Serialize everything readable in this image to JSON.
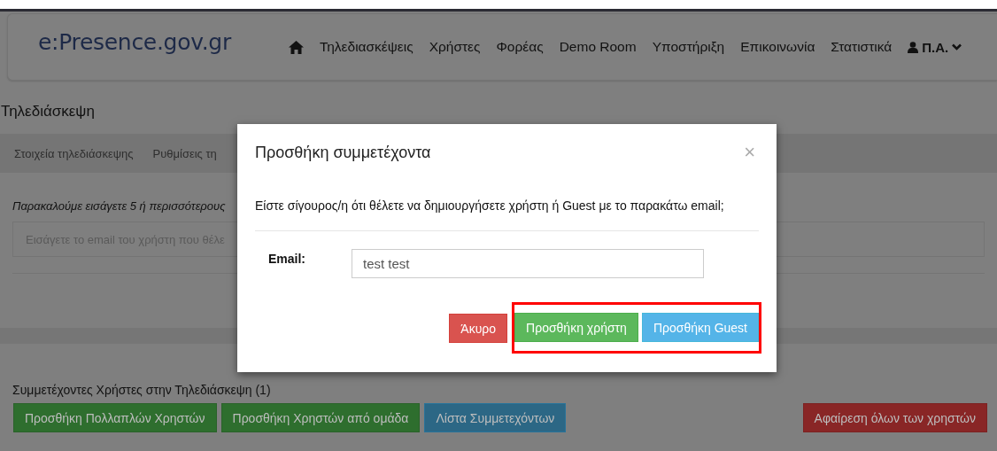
{
  "navbar": {
    "logo": "e:Presence.gov.gr",
    "items": [
      {
        "kind": "home"
      },
      {
        "kind": "link",
        "label": "Τηλεδιασκέψεις"
      },
      {
        "kind": "link",
        "label": "Χρήστες"
      },
      {
        "kind": "link",
        "label": "Φορέας"
      },
      {
        "kind": "link",
        "label": "Demo Room"
      },
      {
        "kind": "link",
        "label": "Υποστήριξη"
      },
      {
        "kind": "link",
        "label": "Επικοινωνία"
      },
      {
        "kind": "link",
        "label": "Στατιστικά"
      },
      {
        "kind": "user",
        "label": "Π.Α."
      }
    ]
  },
  "page": {
    "title": "Τηλεδιάσκεψη",
    "tabs": [
      {
        "label": "Στοιχεία τηλεδιάσκεψης",
        "selected": false
      },
      {
        "label": "Ρυθμίσεις τη",
        "selected": false
      }
    ],
    "instruction": "Παρακαλούμε εισάγετε 5 ή περισσότερους",
    "search": {
      "placeholder": "Εισάγετε το email του χρήστη που θέλε"
    },
    "participants_heading": "Συμμετέχοντες Χρήστες στην Τηλεδιάσκεψη (1)",
    "buttons": [
      {
        "label": "Προσθήκη Πολλαπλών Χρηστών",
        "kind": "success"
      },
      {
        "label": "Προσθήκη Χρηστών από ομάδα",
        "kind": "success"
      },
      {
        "label": "Λίστα Συμμετεχόντων",
        "kind": "info"
      },
      {
        "label": "Αφαίρεση όλων των χρηστών",
        "kind": "danger"
      }
    ]
  },
  "modal": {
    "title": "Προσθήκη συμμετέχοντα",
    "close": "×",
    "message": "Είστε σίγουρος/η ότι θέλετε να δημιουργήσετε χρήστη ή Guest με το παρακάτω email;",
    "email_label": "Email:",
    "email_value": "test test",
    "buttons": [
      {
        "label": "Άκυρο",
        "kind": "danger",
        "highlighted": false
      },
      {
        "label": "Προσθήκη χρήστη",
        "kind": "success",
        "highlighted": true
      },
      {
        "label": "Προσθήκη Guest",
        "kind": "info",
        "highlighted": true
      }
    ]
  }
}
